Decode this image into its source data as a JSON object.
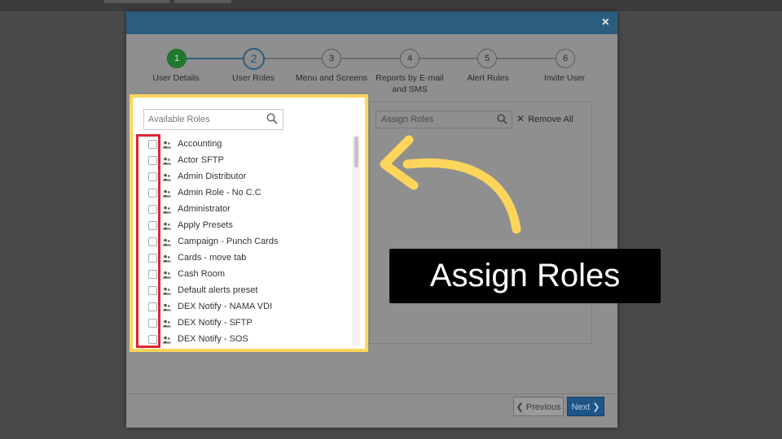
{
  "modal": {
    "close_label": "×",
    "header_color": "#2a5d7e"
  },
  "steps": [
    {
      "number": "1",
      "label": "User Details",
      "state": "done"
    },
    {
      "number": "2",
      "label": "User Roles",
      "state": "active"
    },
    {
      "number": "3",
      "label": "Menu and Screens",
      "state": "pending"
    },
    {
      "number": "4",
      "label": "Reports by E-mail and SMS",
      "state": "pending"
    },
    {
      "number": "5",
      "label": "Alert Rules",
      "state": "pending"
    },
    {
      "number": "6",
      "label": "Invite User",
      "state": "pending"
    }
  ],
  "available": {
    "search_placeholder": "Available Roles",
    "roles": [
      "Accounting",
      "Actor SFTP",
      "Admin Distributor",
      "Admin Role - No C.C",
      "Administrator",
      "Apply Presets",
      "Campaign - Punch Cards",
      "Cards - move tab",
      "Cash Room",
      "Default alerts preset",
      "DEX Notify - NAMA VDI",
      "DEX Notify - SFTP",
      "DEX Notify - SOS"
    ]
  },
  "assigned": {
    "search_placeholder": "Assign Roles",
    "remove_all_label": "Remove All"
  },
  "footer": {
    "previous_label": "Previous",
    "next_label": "Next"
  },
  "annotation": {
    "banner_text": "Assign Roles",
    "highlight_color": "#fdd55a",
    "checkbox_highlight_color": "#e02237"
  },
  "icons": {
    "search": "search-icon",
    "person": "person-icon",
    "close": "close-icon",
    "chevron_left": "chevron-left-icon",
    "chevron_right": "chevron-right-icon"
  }
}
